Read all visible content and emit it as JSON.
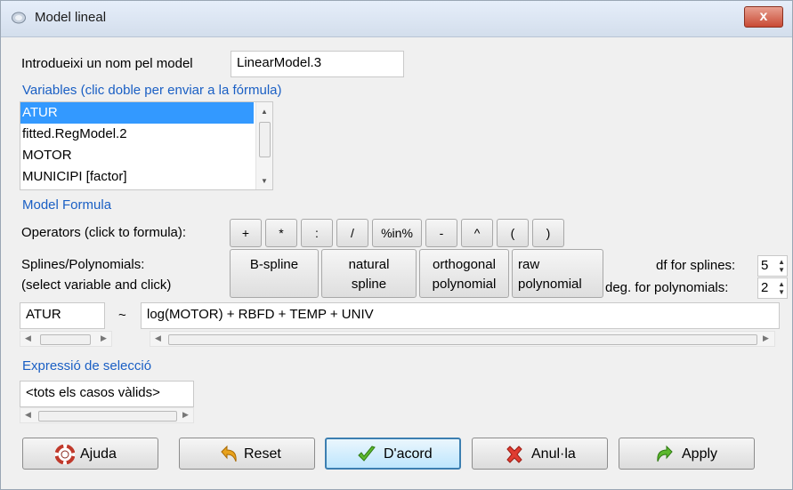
{
  "window": {
    "title": "Model lineal",
    "close_label": "x"
  },
  "model_name": {
    "label": "Introdueixi un nom pel model",
    "value": "LinearModel.3"
  },
  "variables": {
    "heading": "Variables (clic doble per enviar a la fórmula)",
    "items": [
      "ATUR",
      "fitted.RegModel.2",
      "MOTOR",
      "MUNICIPI [factor]"
    ],
    "selected": "ATUR"
  },
  "formula": {
    "heading": "Model Formula",
    "operators_label": "Operators (click to formula):",
    "operators": [
      "+",
      "*",
      ":",
      "/",
      "%in%",
      "-",
      "^",
      "(",
      ")"
    ],
    "splines_label_1": "Splines/Polynomials:",
    "splines_label_2": "(select variable and click)",
    "spline_buttons": [
      {
        "line1": "B-spline",
        "line2": ""
      },
      {
        "line1": "natural",
        "line2": "spline"
      },
      {
        "line1": "orthogonal",
        "line2": "polynomial"
      },
      {
        "line1": "raw",
        "line2": "polynomial"
      }
    ],
    "df_label": "df for splines:",
    "df_value": "5",
    "deg_label": "deg. for polynomials:",
    "deg_value": "2",
    "lhs": "ATUR",
    "tilde": "~",
    "rhs": "log(MOTOR) + RBFD + TEMP + UNIV"
  },
  "subset": {
    "heading": "Expressió de selecció",
    "value": "<tots els casos vàlids>"
  },
  "buttons": {
    "help": "Ajuda",
    "reset": "Reset",
    "ok": "D'acord",
    "cancel": "Anul·la",
    "apply": "Apply"
  },
  "colors": {
    "accent": "#1a5fc4",
    "selection": "#3399ff"
  }
}
